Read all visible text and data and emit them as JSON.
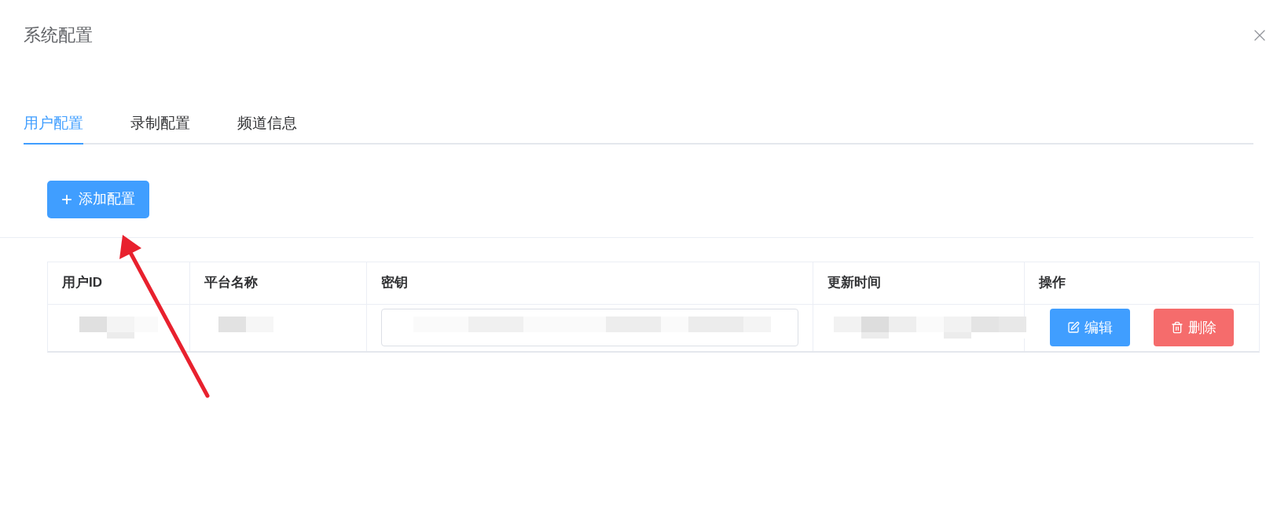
{
  "dialog": {
    "title": "系统配置"
  },
  "tabs": [
    {
      "label": "用户配置",
      "selected": true
    },
    {
      "label": "录制配置",
      "selected": false
    },
    {
      "label": "频道信息",
      "selected": false
    }
  ],
  "add_button": {
    "icon": "+",
    "label": "添加配置"
  },
  "table": {
    "columns": [
      "用户ID",
      "平台名称",
      "密钥",
      "更新时间",
      "操作"
    ],
    "rows": [
      {
        "actions": [
          {
            "kind": "edit",
            "label": "编辑"
          },
          {
            "kind": "delete",
            "label": "删除"
          }
        ]
      }
    ]
  }
}
